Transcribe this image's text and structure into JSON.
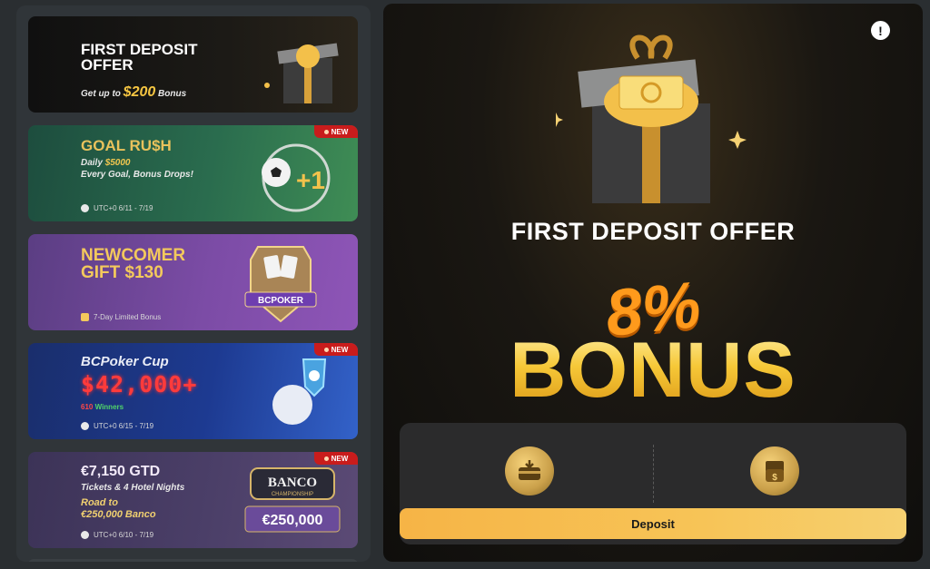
{
  "promos": [
    {
      "title_line1": "FIRST DEPOSIT",
      "title_line2": "OFFER",
      "sub_prefix": "Get up to",
      "sub_amount": "$200",
      "sub_suffix": "Bonus"
    },
    {
      "badge": "NEW",
      "title": "GOAL RU$H",
      "sub_line1_prefix": "Daily",
      "sub_line1_amount": "$5000",
      "sub_line2": "Every Goal, Bonus Drops!",
      "meta": "UTC+0  6/11 - 7/19"
    },
    {
      "title_line1": "NEWCOMER",
      "title_line2": "GIFT $130",
      "meta": "7-Day Limited Bonus",
      "art_label": "BCPOKER"
    },
    {
      "badge": "NEW",
      "title": "BCPoker Cup",
      "led": "$42,000+",
      "winners_count": "610",
      "winners_label": "Winners",
      "meta": "UTC+0  6/15 - 7/19"
    },
    {
      "badge": "NEW",
      "title": "€7,150 GTD",
      "sub": "Tickets & 4 Hotel Nights",
      "sub2_line1": "Road to",
      "sub2_line2": "€250,000 Banco",
      "meta": "UTC+0  6/10 - 7/19",
      "art_title": "BANCO",
      "art_sub": "CHAMPIONSHIP",
      "art_amount": "€250,000"
    }
  ],
  "offer": {
    "title": "FIRST DEPOSIT OFFER",
    "percent": "8%",
    "bonus": "BONUS",
    "deposit_button": "Deposit"
  },
  "colors": {
    "accent_gold": "#f5c43b",
    "accent_orange": "#ff9a1c",
    "badge_red": "#c91c1c"
  }
}
